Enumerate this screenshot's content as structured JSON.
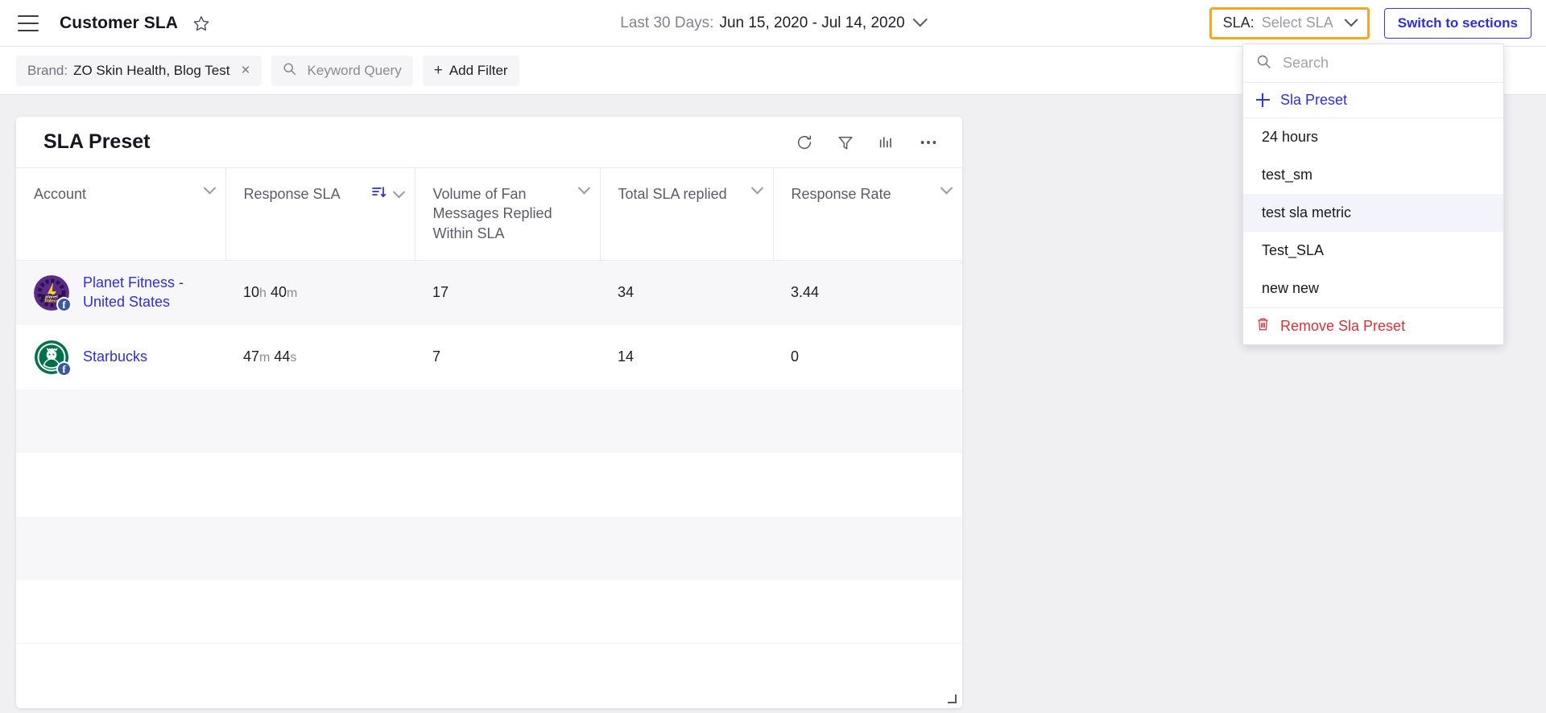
{
  "header": {
    "menu_icon": "hamburger-icon",
    "title": "Customer SLA",
    "favorite_icon": "star-icon",
    "daterange": {
      "label": "Last 30 Days:",
      "value": "Jun 15, 2020 - Jul 14, 2020"
    },
    "sla_selector": {
      "key": "SLA:",
      "value": "Select SLA",
      "highlight_color": "#f5a623"
    },
    "switch_button": "Switch to sections"
  },
  "dropdown": {
    "search_placeholder": "Search",
    "add_label": "Sla Preset",
    "items": [
      {
        "label": "24 hours",
        "selected": false
      },
      {
        "label": "test_sm",
        "selected": false
      },
      {
        "label": "test sla metric",
        "selected": true
      },
      {
        "label": "Test_SLA",
        "selected": false
      },
      {
        "label": "new new",
        "selected": false
      }
    ],
    "remove_label": "Remove Sla Preset",
    "remove_color": "#d0343c"
  },
  "filters": {
    "brand_chip": {
      "key": "Brand:",
      "value": "ZO Skin Health, Blog Test",
      "close": "×"
    },
    "keyword_chip": {
      "placeholder": "Keyword Query"
    },
    "add_filter": {
      "plus": "+",
      "label": "Add Filter"
    }
  },
  "card": {
    "title": "SLA Preset",
    "tools": [
      "refresh-icon",
      "filter-icon",
      "chart-icon",
      "more-icon"
    ],
    "columns": [
      {
        "label": "Account",
        "sorted": false
      },
      {
        "label": "Response SLA",
        "sorted": true
      },
      {
        "label": "Volume of Fan Messages Replied Within SLA",
        "sorted": false
      },
      {
        "label": "Total SLA replied",
        "sorted": false
      },
      {
        "label": "Response Rate",
        "sorted": false
      }
    ],
    "rows": [
      {
        "account": "Planet Fitness - United States",
        "network": "f",
        "avatar": "planet-fitness",
        "response_sla_value": "10",
        "response_sla_unit": "h",
        "response_sla_value2": "40",
        "response_sla_unit2": "m",
        "volume": "17",
        "total": "34",
        "rate": "3.44"
      },
      {
        "account": "Starbucks",
        "network": "f",
        "avatar": "starbucks",
        "response_sla_value": "47",
        "response_sla_unit": "m",
        "response_sla_value2": "44",
        "response_sla_unit2": "s",
        "volume": "7",
        "total": "14",
        "rate": "0"
      }
    ],
    "empty_row_count": 5,
    "resize_handle": "resize-handle"
  }
}
